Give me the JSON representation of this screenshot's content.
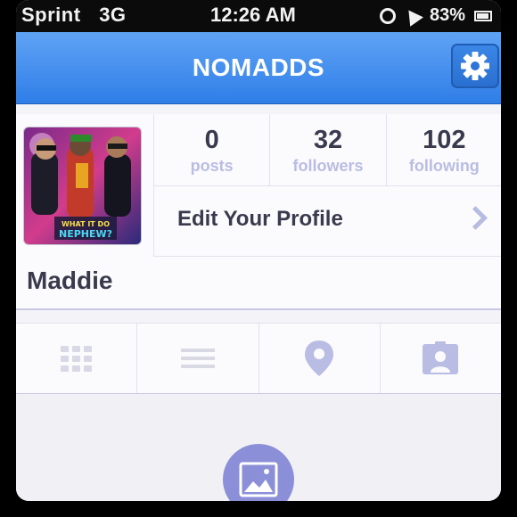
{
  "status_bar": {
    "carrier": "Sprint",
    "network": "3G",
    "time": "12:26 AM",
    "battery_percent": "83%"
  },
  "nav": {
    "title": "NOMADDS"
  },
  "profile": {
    "stats": [
      {
        "value": "0",
        "label": "posts"
      },
      {
        "value": "32",
        "label": "followers"
      },
      {
        "value": "102",
        "label": "following"
      }
    ],
    "edit_label": "Edit Your Profile",
    "name": "Maddie",
    "avatar_text": "WHAT IT DO NEPHEW?"
  },
  "tabs": [
    {
      "icon": "grid-icon"
    },
    {
      "icon": "list-icon"
    },
    {
      "icon": "location-pin-icon"
    },
    {
      "icon": "photos-of-you-icon"
    }
  ],
  "colors": {
    "nav_blue": "#2f7ee8",
    "accent_lavender": "#b9bde4",
    "text_dark": "#3a3a4e",
    "photo_button": "#8b8fd8"
  }
}
